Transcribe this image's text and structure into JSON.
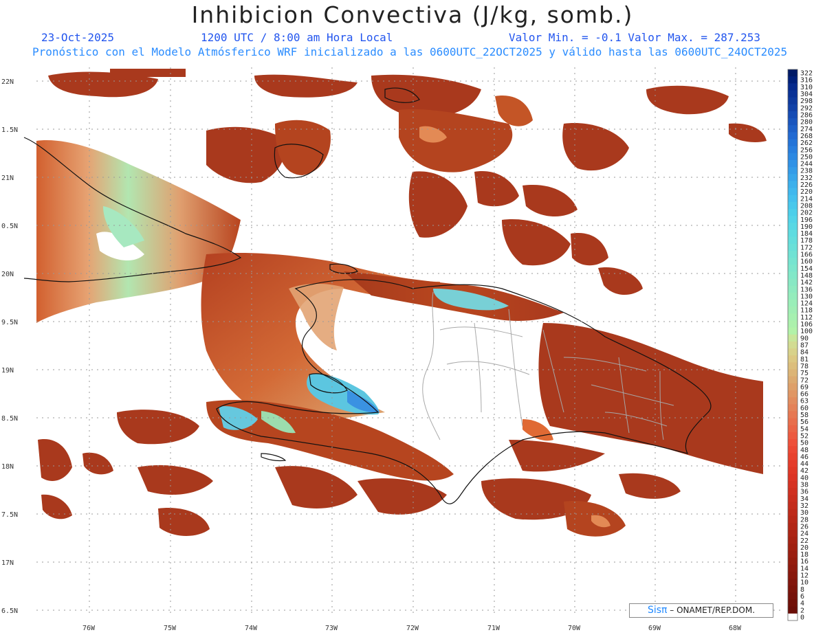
{
  "header": {
    "title": "Inhibicion Convectiva (J/kg, somb.)",
    "date": "23-Oct-2025",
    "time": "1200 UTC / 8:00 am Hora Local",
    "min_max": "Valor Min. = -0.1  Valor Max. = 287.253",
    "forecast_line": "Pronóstico con el Modelo Atmósferico WRF inicializado a las 0600UTC_22OCT2025 y válido hasta las  0600UTC_24OCT2025"
  },
  "map": {
    "lat_labels": [
      "22N",
      "1.5N",
      "21N",
      "0.5N",
      "20N",
      "9.5N",
      "19N",
      "8.5N",
      "18N",
      "7.5N",
      "17N",
      "6.5N"
    ],
    "lon_labels": [
      "76W",
      "75W",
      "74W",
      "73W",
      "72W",
      "71W",
      "70W",
      "69W",
      "68W"
    ],
    "field_colors": {
      "low": "#a9391d",
      "mid": "#d2602f",
      "high": "#e6a272",
      "green": "#9cdcae",
      "cyan": "#66d6de",
      "blue": "#3f9ae6",
      "coast": "#111111",
      "border": "#a8a8a8"
    }
  },
  "colorbar": {
    "labels": [
      "322",
      "316",
      "310",
      "304",
      "298",
      "292",
      "286",
      "280",
      "274",
      "268",
      "262",
      "256",
      "250",
      "244",
      "238",
      "232",
      "226",
      "220",
      "214",
      "208",
      "202",
      "196",
      "190",
      "184",
      "178",
      "172",
      "166",
      "160",
      "154",
      "148",
      "142",
      "136",
      "130",
      "124",
      "118",
      "112",
      "106",
      "100",
      "90",
      "87",
      "84",
      "81",
      "78",
      "75",
      "72",
      "69",
      "66",
      "63",
      "60",
      "58",
      "56",
      "54",
      "52",
      "50",
      "48",
      "46",
      "44",
      "42",
      "40",
      "38",
      "36",
      "34",
      "32",
      "30",
      "28",
      "26",
      "24",
      "22",
      "20",
      "18",
      "16",
      "14",
      "12",
      "10",
      "8",
      "6",
      "4",
      "2",
      "0"
    ],
    "colors": [
      "#001a66",
      "#00207a",
      "#062a8c",
      "#0a3296",
      "#0e3a9e",
      "#1242a8",
      "#164cb4",
      "#1a56be",
      "#1e60c8",
      "#226ad2",
      "#2474d8",
      "#287ede",
      "#2c88e2",
      "#3092e6",
      "#349ce8",
      "#38a6ea",
      "#3cb0ec",
      "#40b8ee",
      "#44c0ee",
      "#48c8ec",
      "#4ccfea",
      "#52d4e8",
      "#58d8e4",
      "#5edce0",
      "#64dedc",
      "#6ae0d8",
      "#70e2d4",
      "#76e4d0",
      "#7ce6cc",
      "#82e8c8",
      "#88e8c4",
      "#8eeac0",
      "#94ecbc",
      "#9aeeb8",
      "#a0eeb4",
      "#a6f0b0",
      "#acf0ac",
      "#b2f2a8",
      "#c8e69a",
      "#d2dc92",
      "#d8d28a",
      "#dcc882",
      "#dcbe7c",
      "#dcb476",
      "#dcaa70",
      "#deA06a",
      "#e09664",
      "#e28c5e",
      "#e48258",
      "#e67852",
      "#e86e4c",
      "#ea6446",
      "#ec5a40",
      "#ee503a",
      "#ec4834",
      "#e8422e",
      "#e43c2a",
      "#e03826",
      "#dc3424",
      "#d63222",
      "#d03020",
      "#ca2e1e",
      "#c42c1c",
      "#be2a1a",
      "#b82818",
      "#b22616",
      "#ac2414",
      "#a62212",
      "#a02010",
      "#9a1e10",
      "#941c0e",
      "#8e1a0e",
      "#88180c",
      "#82160c",
      "#7c140a",
      "#76120a",
      "#701008",
      "#6a0e08",
      "#ffffff"
    ]
  },
  "credit": {
    "sis": "Sisπ",
    "org": " – ONAMET/REP.DOM."
  }
}
